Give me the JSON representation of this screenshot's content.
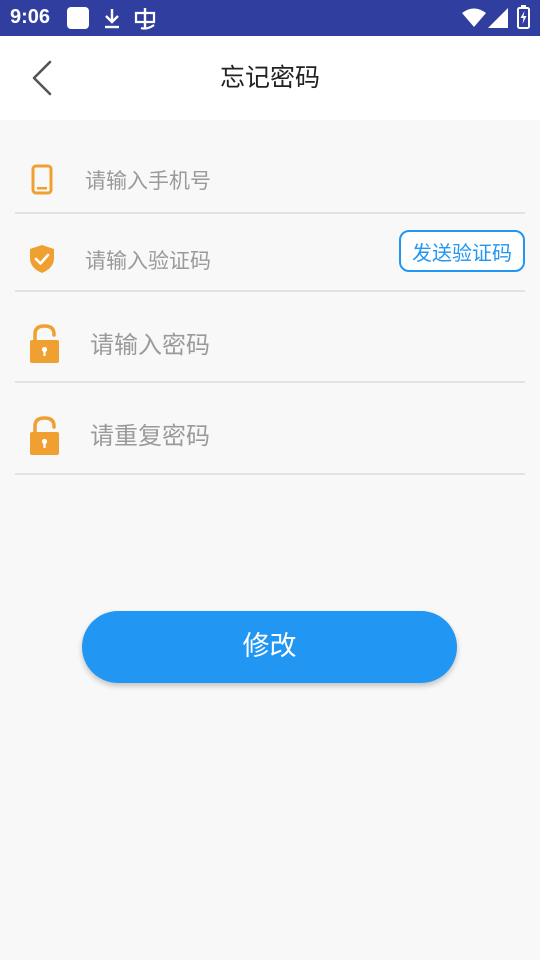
{
  "status_bar": {
    "time": "9:06",
    "background": "#303f9f",
    "icons": [
      "app-notification-icon",
      "download-icon",
      "bug-icon",
      "wifi-icon",
      "signal-icon",
      "battery-icon"
    ]
  },
  "header": {
    "title": "忘记密码",
    "back_icon": "chevron-left-icon"
  },
  "form": {
    "phone": {
      "placeholder": "请输入手机号",
      "value": "",
      "icon": "phone-icon"
    },
    "code": {
      "placeholder": "请输入验证码",
      "value": "",
      "icon": "shield-check-icon",
      "send_label": "发送验证码"
    },
    "password": {
      "placeholder": "请输入密码",
      "value": "",
      "icon": "unlock-icon"
    },
    "confirm_password": {
      "placeholder": "请重复密码",
      "value": "",
      "icon": "unlock-icon"
    }
  },
  "submit": {
    "label": "修改"
  },
  "colors": {
    "accent": "#2196f3",
    "icon_orange": "#f0a030",
    "background": "#f8f8f8"
  }
}
